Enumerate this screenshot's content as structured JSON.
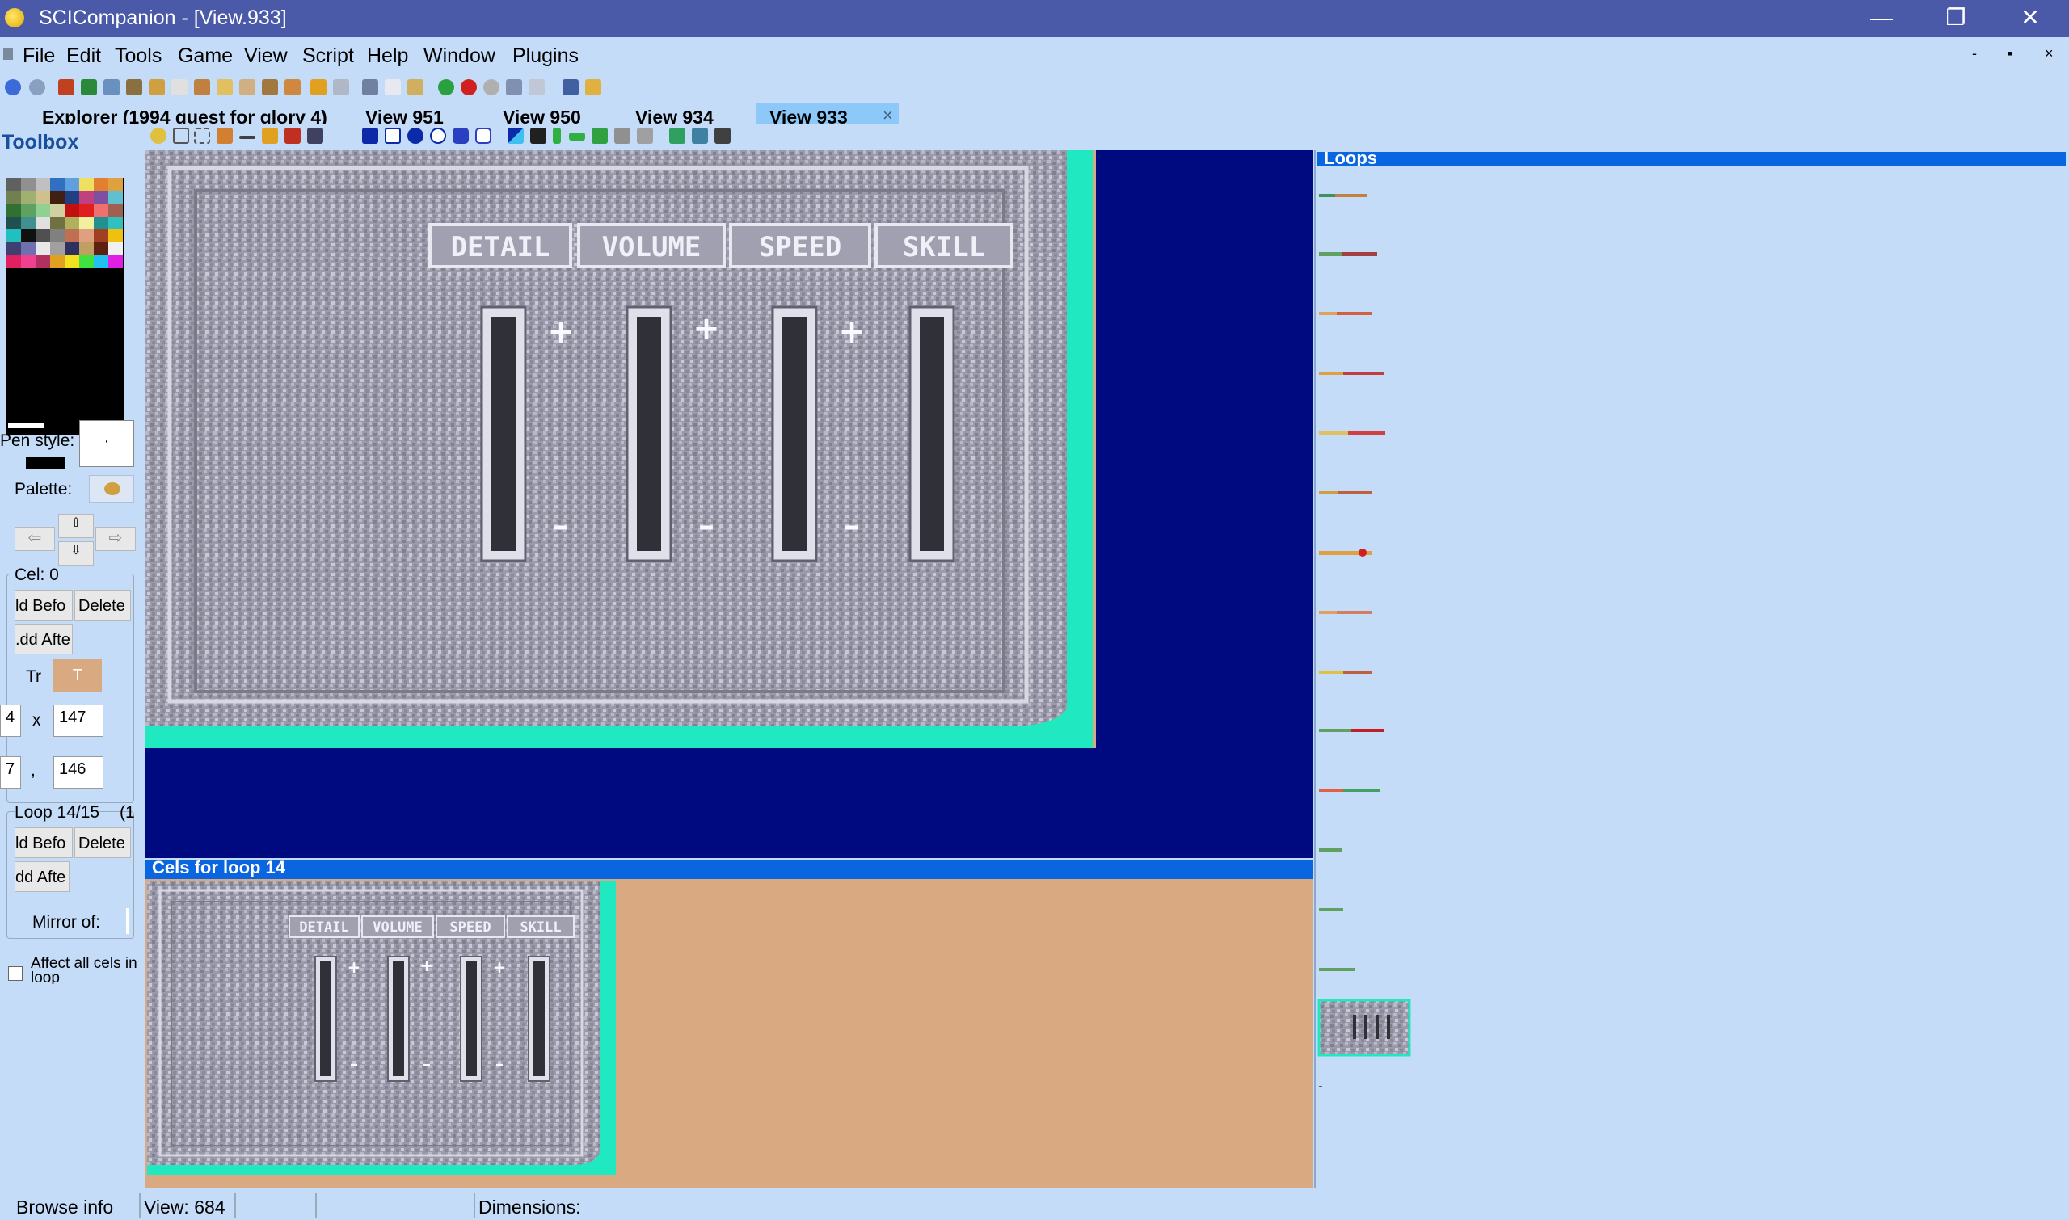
{
  "window": {
    "title": "SCICompanion - [View.933]",
    "min_glyph": "—",
    "max_glyph": "❐",
    "close_glyph": "✕"
  },
  "menu": {
    "items": [
      "File",
      "Edit",
      "Tools",
      "Game",
      "View",
      "Script",
      "Help",
      "Window",
      "Plugins"
    ],
    "mdi_min": "-",
    "mdi_restore": "▪",
    "mdi_close": "×"
  },
  "tabs": [
    {
      "label": "Explorer (1994 quest for glory 4)"
    },
    {
      "label": "View 951"
    },
    {
      "label": "View 950"
    },
    {
      "label": "View 934"
    },
    {
      "label": "View 933"
    }
  ],
  "tab_close": "×",
  "toolbox": {
    "title": "Toolbox",
    "pen_style_label": "Pen style:",
    "pen_value": "·",
    "palette_label": "Palette:",
    "left_arrow": "⇦",
    "right_arrow": "⇨",
    "up_arrow": "⇧",
    "down_arrow": "⇩",
    "cel_label": "Cel: 0",
    "add_before": "ld Befo",
    "delete": "Delete",
    "add_after": ".dd Afte",
    "tr_label": "Tr",
    "t_button": "T",
    "x_left": "4",
    "x_sep": "x",
    "width": "147",
    "y_left": "7",
    "y_sep": ",",
    "height": "146",
    "loop_label": "Loop 14/15",
    "loop_extra": "(1",
    "loop_add_before": "ld Befo",
    "loop_delete": "Delete",
    "loop_add_after": "dd Afte",
    "mirror_label": "Mirror of:",
    "affect_label": "Affect all cels in loop"
  },
  "image_labels": [
    "DETAIL",
    "VOLUME",
    "SPEED",
    "SKILL"
  ],
  "plus": "+",
  "minus": "–",
  "loops_header": "Loops",
  "cels_header": "Cels for loop 14",
  "status": {
    "browse": "Browse info",
    "view": "View: 684",
    "dimensions": "Dimensions:"
  },
  "colors": {
    "titlebar": "#4a59a8",
    "canvas_bg": "#000a80",
    "panel_header": "#0a66e0",
    "cels_bg": "#d9a982",
    "cyan_edge": "#20e8c0",
    "stone": "#9a9aa8"
  }
}
